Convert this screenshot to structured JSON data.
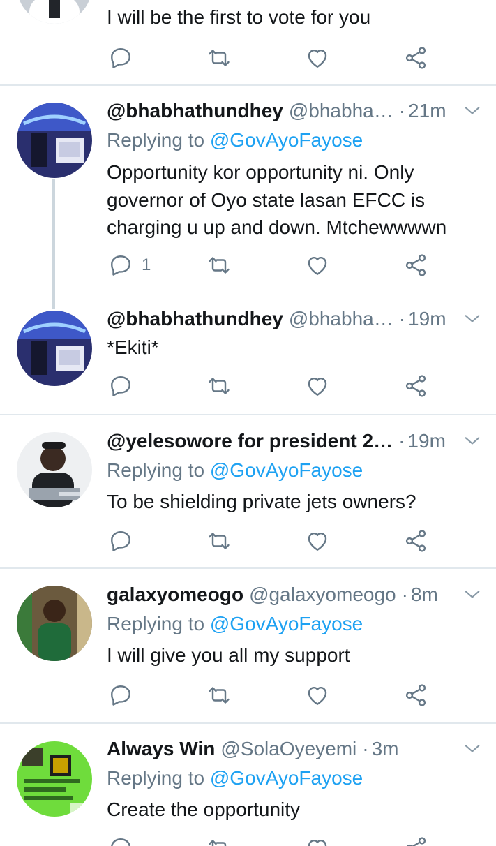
{
  "tweets": [
    {
      "name": "",
      "handle": "",
      "time": "",
      "body": "I will be the first to vote for you",
      "reply_count": ""
    },
    {
      "name": "@bhabhathundhey",
      "handle": "@bhabha…",
      "sep": "·",
      "time": "21m",
      "replying_label": "Replying to",
      "replying_to": "@GovAyoFayose",
      "body": "Opportunity kor opportunity ni. Only governor of Oyo state lasan EFCC is charging u up and down. Mtchewwwwn",
      "reply_count": "1"
    },
    {
      "name": "@bhabhathundhey",
      "handle": "@bhabha…",
      "sep": "·",
      "time": "19m",
      "body": "*Ekiti*",
      "reply_count": ""
    },
    {
      "name": "@yelesowore for president 2…",
      "handle": "",
      "sep": "·",
      "time": "19m",
      "replying_label": "Replying to",
      "replying_to": "@GovAyoFayose",
      "body": "To be shielding private jets owners?",
      "reply_count": ""
    },
    {
      "name": "galaxyomeogo",
      "handle": "@galaxyomeogo",
      "sep": "·",
      "time": "8m",
      "replying_label": "Replying to",
      "replying_to": "@GovAyoFayose",
      "body": "I will give you all my support",
      "reply_count": ""
    },
    {
      "name": "Always Win",
      "handle": "@SolaOyeyemi",
      "sep": "·",
      "time": "3m",
      "replying_label": "Replying to",
      "replying_to": "@GovAyoFayose",
      "body": "Create the opportunity",
      "reply_count": ""
    }
  ],
  "icons": {
    "reply": "reply-icon",
    "retweet": "retweet-icon",
    "like": "heart-icon",
    "share": "share-icon",
    "caret": "chevron-down-icon"
  },
  "colors": {
    "link": "#1da1f2",
    "secondary": "#657786",
    "text": "#14171a",
    "divider": "#e1e8ed",
    "thread_line": "#ccd6dd"
  }
}
